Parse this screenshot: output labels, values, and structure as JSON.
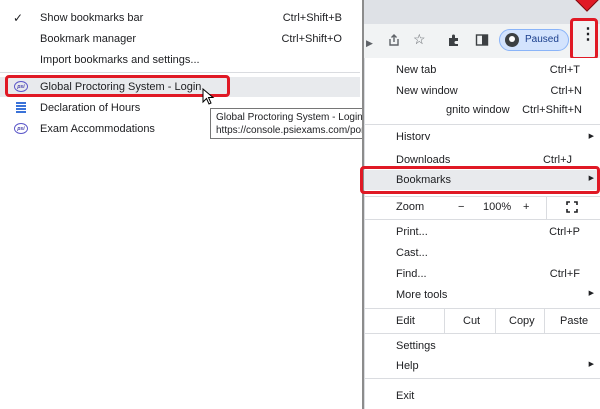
{
  "bookmarks_submenu": {
    "items": [
      {
        "label": "Show bookmarks bar",
        "shortcut": "Ctrl+Shift+B",
        "checked": "✓"
      },
      {
        "label": "Bookmark manager",
        "shortcut": "Ctrl+Shift+O"
      },
      {
        "label": "Import bookmarks and settings..."
      }
    ],
    "bookmarks": [
      {
        "label": "Global Proctoring System - Login",
        "icon": "psi-favicon-icon"
      },
      {
        "label": "Declaration of Hours",
        "icon": "document-icon"
      },
      {
        "label": "Exam Accommodations",
        "icon": "psi-favicon-icon"
      }
    ],
    "favicon_text": "psi"
  },
  "tooltip": {
    "title": "Global Proctoring System - Login",
    "url": "https://console.psiexams.com/portal/index.jsp"
  },
  "toolbar": {
    "profile_label": "Paused",
    "icons": [
      "share-icon",
      "star-icon",
      "extensions-icon",
      "side-panel-icon",
      "profile-icon",
      "kebab-menu-icon"
    ]
  },
  "chrome_menu": {
    "new_tab": {
      "label": "New tab",
      "shortcut": "Ctrl+T"
    },
    "new_window": {
      "label": "New window",
      "shortcut": "Ctrl+N"
    },
    "incognito": {
      "label": "gnito window",
      "shortcut": "Ctrl+Shift+N"
    },
    "history": {
      "label": "History"
    },
    "downloads": {
      "label": "Downloads",
      "shortcut": "Ctrl+J"
    },
    "bookmarks": {
      "label": "Bookmarks"
    },
    "zoom": {
      "label": "Zoom",
      "minus": "−",
      "value": "100%",
      "plus": "+"
    },
    "print": {
      "label": "Print...",
      "shortcut": "Ctrl+P"
    },
    "cast": {
      "label": "Cast..."
    },
    "find": {
      "label": "Find...",
      "shortcut": "Ctrl+F"
    },
    "more_tools": {
      "label": "More tools"
    },
    "edit": {
      "label": "Edit",
      "cut": "Cut",
      "copy": "Copy",
      "paste": "Paste"
    },
    "settings": {
      "label": "Settings"
    },
    "help": {
      "label": "Help"
    },
    "exit": {
      "label": "Exit"
    }
  },
  "colors": {
    "highlight_red": "#e01925",
    "hover_gray": "#e8eaed",
    "profile_blue": "#d3e3fd"
  }
}
